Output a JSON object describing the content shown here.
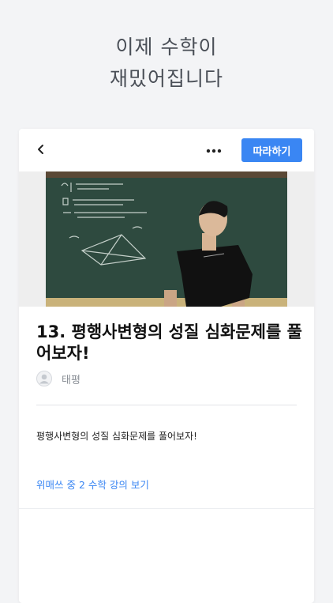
{
  "promo": {
    "line1": "이제 수학이",
    "line2": "재밌어집니다"
  },
  "header": {
    "back_icon": "chevron-left-icon",
    "more_icon": "more-horizontal-icon",
    "follow_label": "따라하기"
  },
  "video": {
    "title": "13. 평행사변형의 성질 심화문제를 풀어보자!",
    "author": "태평",
    "description": "평행사변형의 성질 심화문제를 풀어보자!",
    "series_link": "위매쓰 중 2 수학 강의 보기"
  },
  "colors": {
    "accent": "#3a86f3",
    "background": "#f3f4f6",
    "card": "#ffffff",
    "chalkboard": "#2e4a3f"
  }
}
